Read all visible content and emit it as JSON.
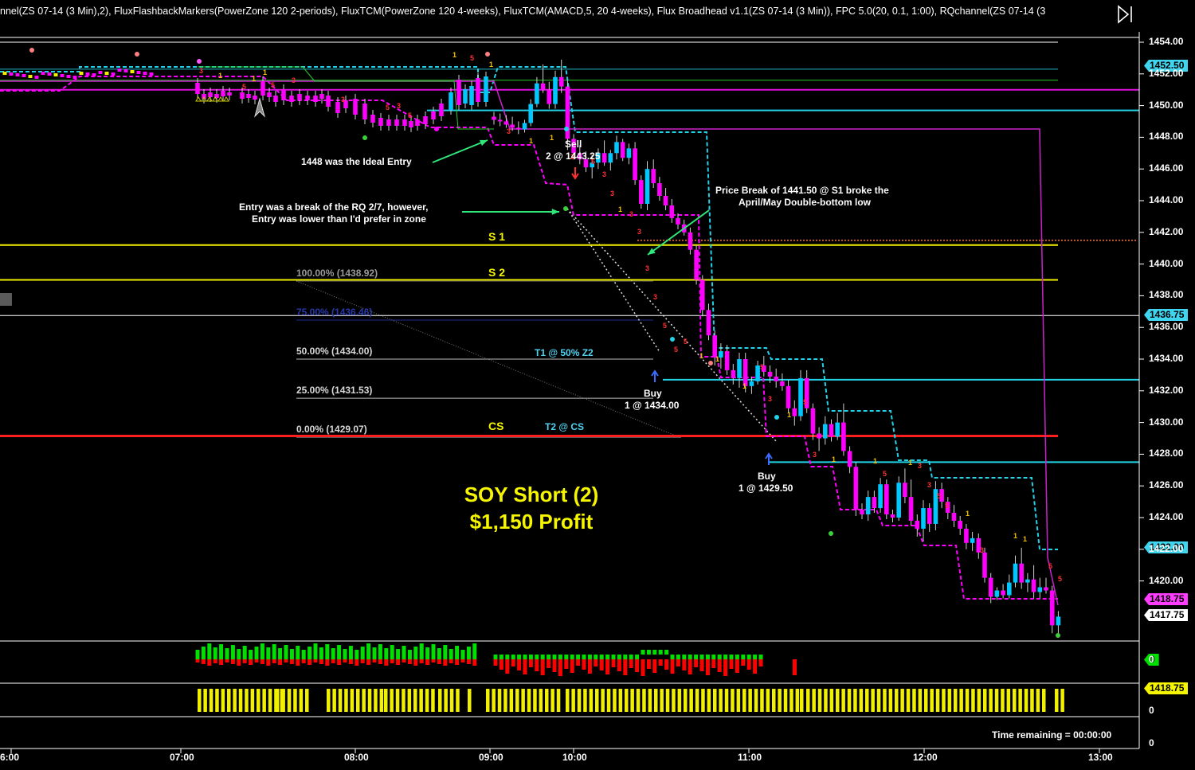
{
  "header": {
    "indicators": "nnel(ZS 07-14 (3 Min),2), FluxFlashbackMarkers(PowerZone 120 2-periods), FluxTCM(PowerZone 120 4-weeks), FluxTCM(AMACD,5, 20 4-weeks), Flux Broadhead v1.1(ZS 07-14 (3 Min)), FPC 5.0(20, 0.1, 1:00), RQchannel(ZS 07-14 (3"
  },
  "annotations": {
    "ideal_entry": "1448 was the Ideal Entry",
    "entry_break_1": "Entry was a break of the RQ 2/7, however,",
    "entry_break_2": "Entry was lower than I'd prefer in zone",
    "sell_1": "Sell",
    "sell_2": "2 @ 1443.25",
    "price_break_1": "Price Break of 1441.50 @ S1 broke the",
    "price_break_2": "April/May Double-bottom low",
    "buy1_1": "Buy",
    "buy1_2": "1 @ 1434.00",
    "buy2_1": "Buy",
    "buy2_2": "1 @ 1429.50",
    "t1": "T1 @ 50% Z2",
    "t2": "T2 @ CS",
    "title_1": "SOY Short (2)",
    "title_2": "$1,150 Profit",
    "time_remaining": "Time remaining = 00:00:00"
  },
  "levels": {
    "s1": "S 1",
    "s2": "S 2",
    "cs": "CS"
  },
  "fib_labels": {
    "f100": "100.00% (1438.92)",
    "f75": "75.00% (1436.46)",
    "f50": "50.00% (1434.00)",
    "f25": "25.00% (1431.53)",
    "f0": "0.00% (1429.07)"
  },
  "badges": {
    "b1": "1452.50",
    "b2": "1436.75",
    "b3": "1422.00",
    "b4": "1418.75",
    "b5": "1417.75",
    "b6": "0",
    "b7": "1418.75"
  },
  "colors": {
    "candle_down": "#ff00ff",
    "candle_up": "#00c8ff",
    "s_levels": "#f0f000",
    "cs_line": "#ff1e1e",
    "rq_cyan": "#22d3e8",
    "rq_magenta": "#ff00ff",
    "volume_up": "#00e000",
    "volume_down": "#ff0000",
    "bottom_bars": "#f0f000"
  },
  "chart_data": {
    "type": "candlestick",
    "symbol": "ZS 07-14 (3 Min)",
    "ylim": [
      1416,
      1455
    ],
    "y_ticks": [
      1454.0,
      1452.0,
      1450.0,
      1448.0,
      1446.0,
      1444.0,
      1442.0,
      1440.0,
      1438.0,
      1436.0,
      1434.0,
      1432.0,
      1430.0,
      1428.0,
      1426.0,
      1424.0,
      1422.0,
      1420.0
    ],
    "y_tick_labels": [
      "1454.00",
      "1452.00",
      "1450.00",
      "1448.00",
      "1446.00",
      "1444.00",
      "1442.00",
      "1440.00",
      "1438.00",
      "1436.00",
      "1434.00",
      "1432.00",
      "1430.00",
      "1428.00",
      "1426.00",
      "1424.00",
      "1422.00",
      "1420.00"
    ],
    "x_tick_labels": [
      "6:00",
      "07:00",
      "08:00",
      "09:00",
      "10:00",
      "11:00",
      "12:00",
      "13:00"
    ],
    "horizontal_levels": {
      "S1": 1441.2,
      "S2": 1439.0,
      "CS": 1429.15,
      "fib_100": 1438.92,
      "fib_75": 1436.46,
      "fib_50": 1434.0,
      "fib_25": 1431.53,
      "fib_0": 1429.07
    },
    "trades": [
      {
        "side": "Sell",
        "qty": 2,
        "price": 1443.25
      },
      {
        "side": "Buy",
        "qty": 1,
        "price": 1434.0
      },
      {
        "side": "Buy",
        "qty": 1,
        "price": 1429.5
      }
    ],
    "candles_ohlc": [
      [
        1449.3,
        1449.6,
        1448.8,
        1449.1
      ],
      [
        1449.1,
        1449.5,
        1448.7,
        1449.0
      ],
      [
        1449.0,
        1449.4,
        1448.6,
        1448.8
      ],
      [
        1448.8,
        1449.3,
        1448.4,
        1448.6
      ],
      [
        1448.6,
        1449.0,
        1448.2,
        1448.5
      ],
      [
        1448.5,
        1449.1,
        1448.3,
        1448.9
      ],
      [
        1448.9,
        1450.4,
        1448.7,
        1450.1
      ],
      [
        1450.1,
        1451.8,
        1449.9,
        1451.4
      ],
      [
        1451.4,
        1452.6,
        1450.8,
        1451.0
      ],
      [
        1451.0,
        1451.5,
        1449.8,
        1450.1
      ],
      [
        1450.1,
        1452.2,
        1449.8,
        1451.8
      ],
      [
        1451.8,
        1452.9,
        1450.8,
        1451.2
      ],
      [
        1451.2,
        1451.6,
        1447.2,
        1447.9
      ],
      [
        1447.9,
        1448.2,
        1446.6,
        1447.0
      ],
      [
        1447.0,
        1447.5,
        1446.3,
        1446.6
      ],
      [
        1446.6,
        1447.1,
        1445.8,
        1446.1
      ],
      [
        1446.1,
        1446.9,
        1445.4,
        1446.4
      ],
      [
        1446.4,
        1447.3,
        1446.0,
        1447.0
      ],
      [
        1447.0,
        1447.8,
        1446.2,
        1446.4
      ],
      [
        1446.4,
        1447.2,
        1445.9,
        1447.0
      ],
      [
        1447.0,
        1448.1,
        1446.6,
        1447.7
      ],
      [
        1447.7,
        1447.9,
        1446.5,
        1446.7
      ],
      [
        1446.7,
        1447.6,
        1446.3,
        1447.3
      ],
      [
        1447.3,
        1447.7,
        1445.0,
        1445.3
      ],
      [
        1445.3,
        1445.6,
        1443.5,
        1443.8
      ],
      [
        1443.8,
        1446.5,
        1443.4,
        1446.0
      ],
      [
        1446.0,
        1446.6,
        1444.8,
        1445.1
      ],
      [
        1445.1,
        1445.5,
        1444.0,
        1444.3
      ],
      [
        1444.3,
        1444.8,
        1443.4,
        1443.7
      ],
      [
        1443.7,
        1444.1,
        1442.6,
        1442.9
      ],
      [
        1442.9,
        1443.2,
        1442.2,
        1442.5
      ],
      [
        1442.5,
        1442.8,
        1441.8,
        1442.0
      ],
      [
        1442.0,
        1442.3,
        1440.6,
        1440.9
      ],
      [
        1440.9,
        1441.2,
        1438.7,
        1439.0
      ],
      [
        1439.0,
        1439.3,
        1436.7,
        1437.1
      ],
      [
        1437.1,
        1437.5,
        1435.2,
        1435.5
      ],
      [
        1435.5,
        1435.8,
        1433.6,
        1434.1
      ],
      [
        1434.1,
        1435.0,
        1433.4,
        1434.5
      ],
      [
        1434.5,
        1434.9,
        1433.0,
        1433.3
      ],
      [
        1433.3,
        1433.7,
        1432.4,
        1432.8
      ],
      [
        1432.8,
        1434.4,
        1432.2,
        1434.0
      ],
      [
        1434.0,
        1434.4,
        1431.9,
        1432.3
      ],
      [
        1432.3,
        1432.9,
        1431.8,
        1432.6
      ],
      [
        1432.6,
        1433.9,
        1432.4,
        1433.6
      ],
      [
        1433.6,
        1434.2,
        1432.9,
        1433.2
      ],
      [
        1433.2,
        1433.6,
        1432.5,
        1432.9
      ],
      [
        1432.9,
        1433.4,
        1432.2,
        1432.6
      ],
      [
        1432.6,
        1433.1,
        1432.0,
        1432.3
      ],
      [
        1432.3,
        1432.7,
        1430.6,
        1430.9
      ],
      [
        1430.9,
        1431.4,
        1429.8,
        1430.4
      ],
      [
        1430.4,
        1433.3,
        1430.1,
        1432.8
      ],
      [
        1432.8,
        1433.3,
        1430.6,
        1430.9
      ],
      [
        1430.9,
        1431.2,
        1428.9,
        1429.3
      ],
      [
        1429.3,
        1429.7,
        1428.2,
        1429.0
      ],
      [
        1429.0,
        1430.4,
        1428.6,
        1429.9
      ],
      [
        1429.9,
        1430.2,
        1428.8,
        1429.1
      ],
      [
        1429.1,
        1430.6,
        1428.9,
        1430.0
      ],
      [
        1430.0,
        1431.2,
        1427.9,
        1428.2
      ],
      [
        1428.2,
        1428.5,
        1426.8,
        1427.2
      ],
      [
        1427.2,
        1427.5,
        1424.1,
        1424.5
      ],
      [
        1424.5,
        1424.9,
        1423.9,
        1424.2
      ],
      [
        1424.2,
        1425.7,
        1423.8,
        1425.3
      ],
      [
        1425.3,
        1425.7,
        1424.3,
        1424.6
      ],
      [
        1424.6,
        1426.5,
        1424.3,
        1426.1
      ],
      [
        1426.1,
        1426.4,
        1423.9,
        1424.2
      ],
      [
        1424.2,
        1424.5,
        1423.7,
        1424.0
      ],
      [
        1424.0,
        1426.6,
        1423.8,
        1426.2
      ],
      [
        1426.2,
        1427.1,
        1424.9,
        1425.3
      ],
      [
        1425.3,
        1426.4,
        1423.5,
        1423.8
      ],
      [
        1423.8,
        1424.2,
        1422.8,
        1423.3
      ],
      [
        1423.3,
        1425.1,
        1422.5,
        1424.6
      ],
      [
        1424.6,
        1424.9,
        1423.1,
        1423.6
      ],
      [
        1423.6,
        1426.3,
        1423.2,
        1425.8
      ],
      [
        1425.8,
        1426.2,
        1424.6,
        1425.0
      ],
      [
        1425.0,
        1425.3,
        1423.9,
        1424.3
      ],
      [
        1424.3,
        1424.8,
        1423.4,
        1423.8
      ],
      [
        1423.8,
        1424.1,
        1422.9,
        1423.3
      ],
      [
        1423.3,
        1423.6,
        1422.0,
        1422.4
      ],
      [
        1422.4,
        1423.1,
        1421.9,
        1422.7
      ],
      [
        1422.7,
        1423.0,
        1421.4,
        1421.8
      ],
      [
        1421.8,
        1422.1,
        1419.9,
        1420.2
      ],
      [
        1420.2,
        1420.5,
        1418.6,
        1419.0
      ],
      [
        1419.0,
        1419.6,
        1418.8,
        1419.4
      ],
      [
        1419.4,
        1419.8,
        1418.9,
        1419.1
      ],
      [
        1419.1,
        1420.4,
        1418.9,
        1419.9
      ],
      [
        1419.9,
        1421.6,
        1419.6,
        1421.1
      ],
      [
        1421.1,
        1422.1,
        1419.5,
        1419.9
      ],
      [
        1419.9,
        1420.5,
        1419.3,
        1420.1
      ],
      [
        1420.1,
        1421.0,
        1418.9,
        1419.3
      ],
      [
        1419.3,
        1420.2,
        1418.9,
        1419.6
      ],
      [
        1419.6,
        1420.2,
        1419.2,
        1419.4
      ],
      [
        1419.4,
        1419.7,
        1416.7,
        1417.2
      ],
      [
        1417.2,
        1418.1,
        1416.6,
        1417.75
      ]
    ]
  }
}
